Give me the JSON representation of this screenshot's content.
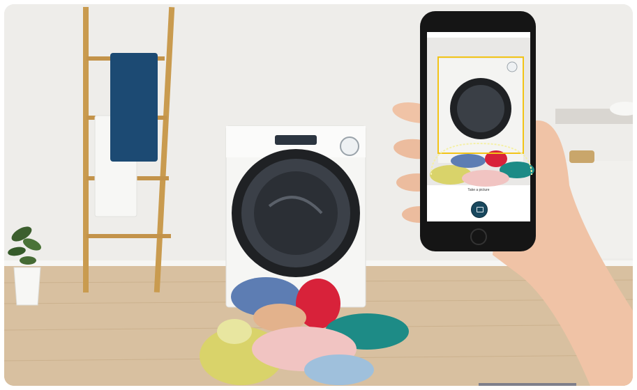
{
  "phone_app": {
    "caption": "Take a picture",
    "left_button": "",
    "right_button": ""
  },
  "colors": {
    "towel_blue": "#1c4a73",
    "laundry_red": "#d8223a",
    "laundry_teal": "#1d8b86",
    "floor_wood": "#d6bd9b",
    "frame_yellow": "#f2c417"
  }
}
